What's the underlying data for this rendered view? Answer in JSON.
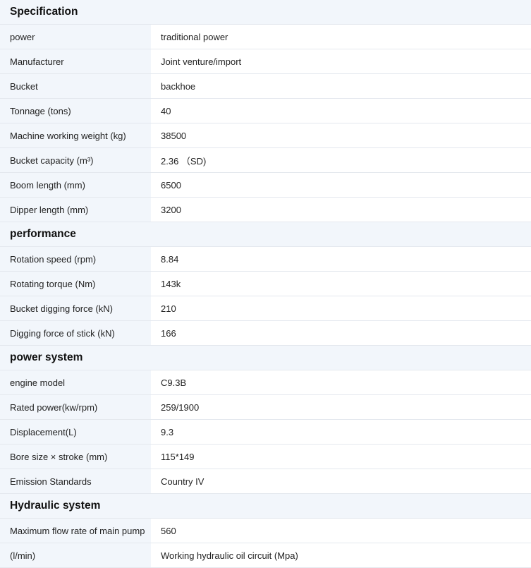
{
  "sections": [
    {
      "title": "Specification",
      "rows": [
        {
          "label": "power",
          "value": "traditional power"
        },
        {
          "label": "Manufacturer",
          "value": "Joint venture/import"
        },
        {
          "label": "Bucket",
          "value": "backhoe"
        },
        {
          "label": "Tonnage (tons)",
          "value": "40"
        },
        {
          "label": "Machine working weight (kg)",
          "value": "38500"
        },
        {
          "label": "Bucket capacity (m³)",
          "value": "2.36 （SD)"
        },
        {
          "label": "Boom length (mm)",
          "value": "6500"
        },
        {
          "label": "Dipper length (mm)",
          "value": "3200"
        }
      ]
    },
    {
      "title": "performance",
      "rows": [
        {
          "label": "Rotation speed (rpm)",
          "value": "8.84"
        },
        {
          "label": "Rotating torque (Nm)",
          "value": "143k"
        },
        {
          "label": "Bucket digging force (kN)",
          "value": "210"
        },
        {
          "label": "Digging force of stick (kN)",
          "value": "166"
        }
      ]
    },
    {
      "title": "power system",
      "rows": [
        {
          "label": "engine model",
          "value": "C9.3B"
        },
        {
          "label": "Rated power(kw/rpm)",
          "value": "259/1900"
        },
        {
          "label": "Displacement(L)",
          "value": "9.3"
        },
        {
          "label": "Bore size × stroke (mm)",
          "value": "115*149"
        },
        {
          "label": "Emission Standards",
          "value": "Country IV"
        }
      ]
    },
    {
      "title": "Hydraulic system",
      "rows": [
        {
          "label": "Maximum flow rate of main pump",
          "value": "560"
        },
        {
          "label": "(l/min)",
          "value": "Working hydraulic oil circuit (Mpa)"
        }
      ]
    }
  ]
}
